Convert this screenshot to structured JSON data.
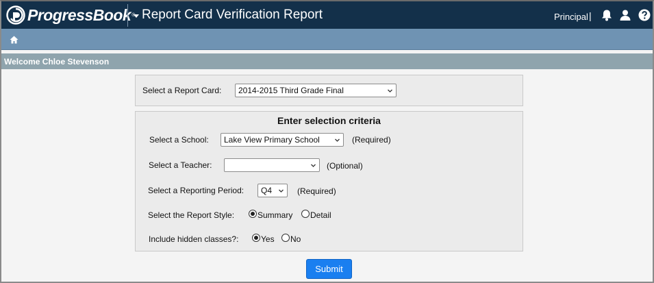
{
  "header": {
    "brand": "ProgressBook",
    "title": "Report Card Verification Report",
    "role": "Principal",
    "role_separator": "|",
    "icons": [
      "bell-icon",
      "user-icon",
      "help-icon"
    ]
  },
  "nav": {
    "home_icon": "home-icon"
  },
  "welcome": "Welcome Chloe Stevenson",
  "report_card": {
    "label": "Select a Report Card:",
    "selected": "2014-2015 Third Grade Final"
  },
  "criteria": {
    "title": "Enter selection criteria",
    "school": {
      "label": "Select a School:",
      "selected": "Lake View Primary School",
      "note": "(Required)"
    },
    "teacher": {
      "label": "Select a Teacher:",
      "selected": "",
      "note": "(Optional)"
    },
    "period": {
      "label": "Select a Reporting Period:",
      "selected": "Q4",
      "note": "(Required)"
    },
    "style": {
      "label": "Select the Report Style:",
      "options": [
        "Summary",
        "Detail"
      ],
      "selected": "Summary"
    },
    "hidden": {
      "label": "Include hidden classes?:",
      "options": [
        "Yes",
        "No"
      ],
      "selected": "Yes"
    }
  },
  "submit_label": "Submit",
  "colors": {
    "topbar": "#13304a",
    "navbar": "#6f93b3",
    "welcome_bar": "#8fa4ad",
    "submit": "#1a7ff0"
  }
}
